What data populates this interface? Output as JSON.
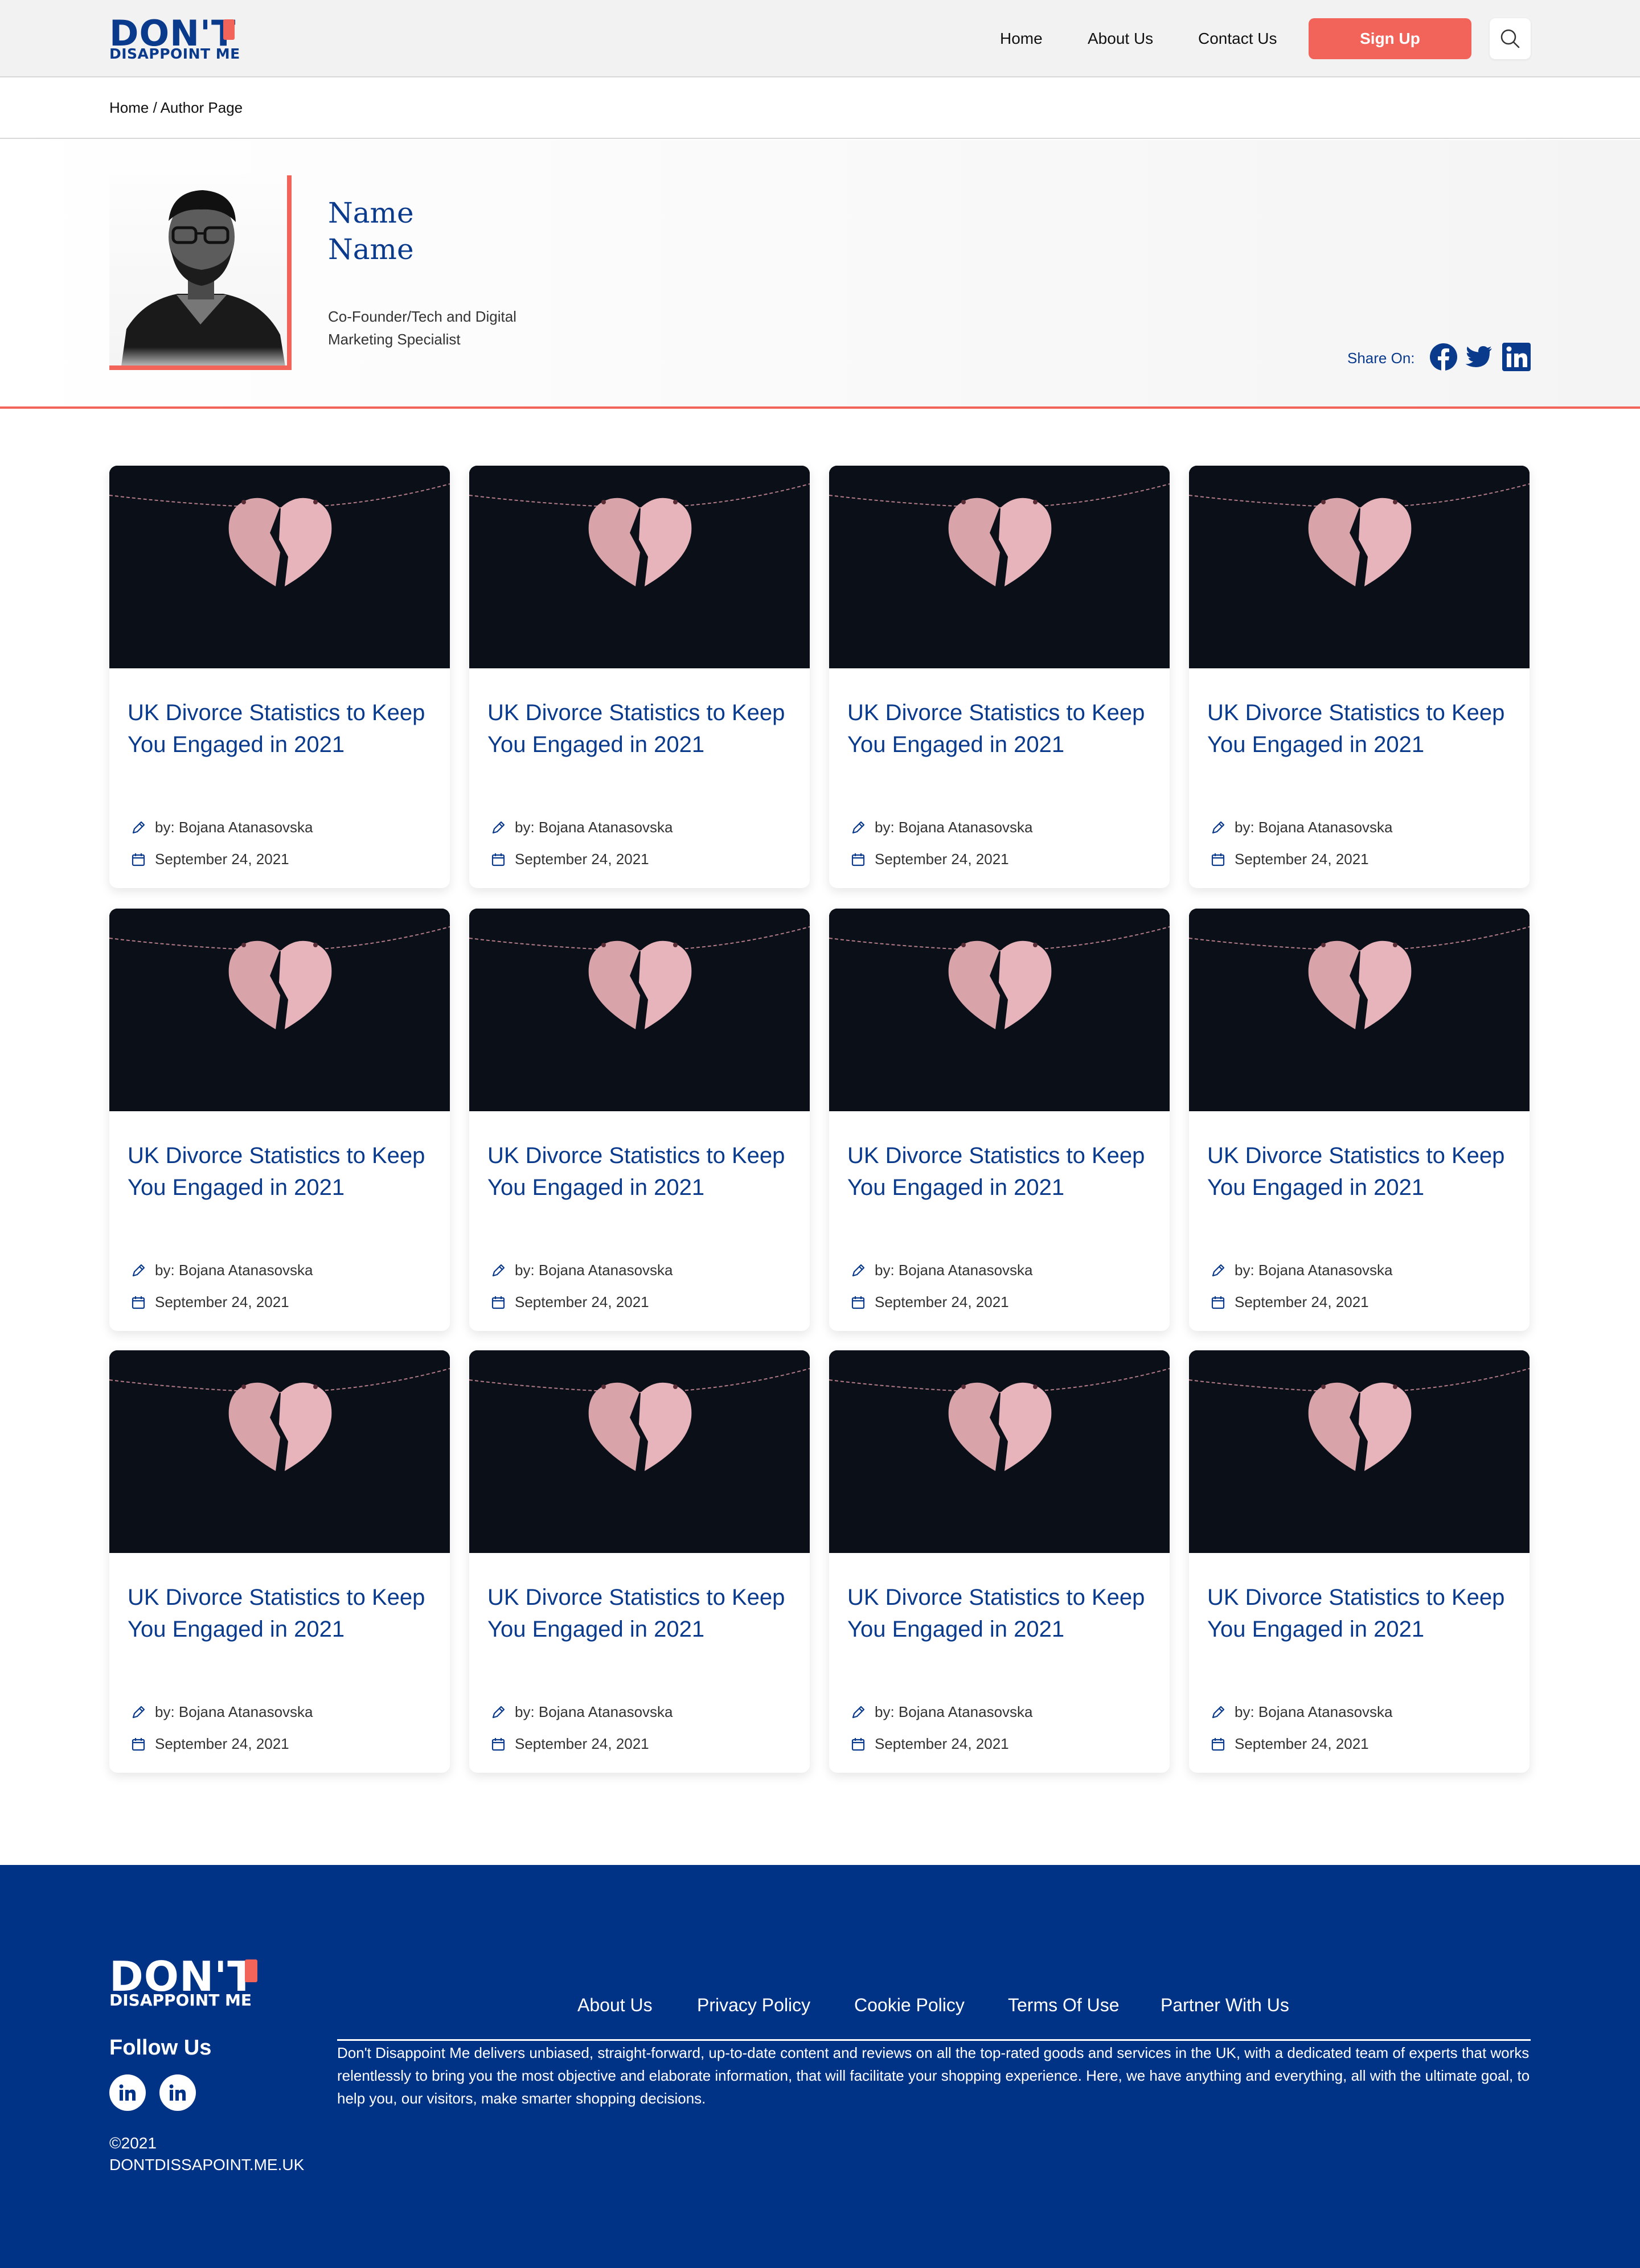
{
  "brand": {
    "logo_big": "DON'T",
    "logo_small": "DISAPPOINT ME"
  },
  "nav": {
    "home": "Home",
    "about": "About Us",
    "contact": "Contact Us",
    "signup": "Sign Up"
  },
  "breadcrumb": "Home / Author Page",
  "author": {
    "name": "Name\nName",
    "role": "Co-Founder/Tech and Digital Marketing Specialist",
    "share_label": "Share On:"
  },
  "cards": [
    {
      "title": "UK Divorce Statistics to Keep You Engaged in 2021",
      "author": "by: Bojana Atanasovska",
      "date": "September 24, 2021"
    },
    {
      "title": "UK Divorce Statistics to Keep You Engaged in 2021",
      "author": "by: Bojana Atanasovska",
      "date": "September 24, 2021"
    },
    {
      "title": "UK Divorce Statistics to Keep You Engaged in 2021",
      "author": "by: Bojana Atanasovska",
      "date": "September 24, 2021"
    },
    {
      "title": "UK Divorce Statistics to Keep You Engaged in 2021",
      "author": "by: Bojana Atanasovska",
      "date": "September 24, 2021"
    },
    {
      "title": "UK Divorce Statistics to Keep You Engaged in 2021",
      "author": "by: Bojana Atanasovska",
      "date": "September 24, 2021"
    },
    {
      "title": "UK Divorce Statistics to Keep You Engaged in 2021",
      "author": "by: Bojana Atanasovska",
      "date": "September 24, 2021"
    },
    {
      "title": "UK Divorce Statistics to Keep You Engaged in 2021",
      "author": "by: Bojana Atanasovska",
      "date": "September 24, 2021"
    },
    {
      "title": "UK Divorce Statistics to Keep You Engaged in 2021",
      "author": "by: Bojana Atanasovska",
      "date": "September 24, 2021"
    },
    {
      "title": "UK Divorce Statistics to Keep You Engaged in 2021",
      "author": "by: Bojana Atanasovska",
      "date": "September 24, 2021"
    },
    {
      "title": "UK Divorce Statistics to Keep You Engaged in 2021",
      "author": "by: Bojana Atanasovska",
      "date": "September 24, 2021"
    },
    {
      "title": "UK Divorce Statistics to Keep You Engaged in 2021",
      "author": "by: Bojana Atanasovska",
      "date": "September 24, 2021"
    },
    {
      "title": "UK Divorce Statistics to Keep You Engaged in 2021",
      "author": "by: Bojana Atanasovska",
      "date": "September 24, 2021"
    }
  ],
  "footer": {
    "follow": "Follow Us",
    "copyright": "©2021\nDONTDISSAPOINT.ME.UK",
    "links": [
      "About Us",
      "Privacy Policy",
      "Cookie Policy",
      "Terms Of Use",
      "Partner With Us"
    ],
    "description": "Don't Disappoint Me delivers unbiased, straight-forward, up-to-date content and reviews on all the top-rated goods and services in the UK, with a dedicated team of experts that works relentlessly to bring you the most objective and elaborate information, that will facilitate your shopping experience. Here, we have anything and everything, all with the ultimate goal, to help you, our visitors, make smarter shopping decisions."
  },
  "colors": {
    "brand_blue": "#0a3a8c",
    "accent": "#f2645a",
    "footer_bg": "#003286"
  },
  "icons": [
    "search-icon",
    "facebook-icon",
    "twitter-icon",
    "linkedin-icon",
    "pencil-icon",
    "calendar-icon",
    "broken-heart-image"
  ]
}
